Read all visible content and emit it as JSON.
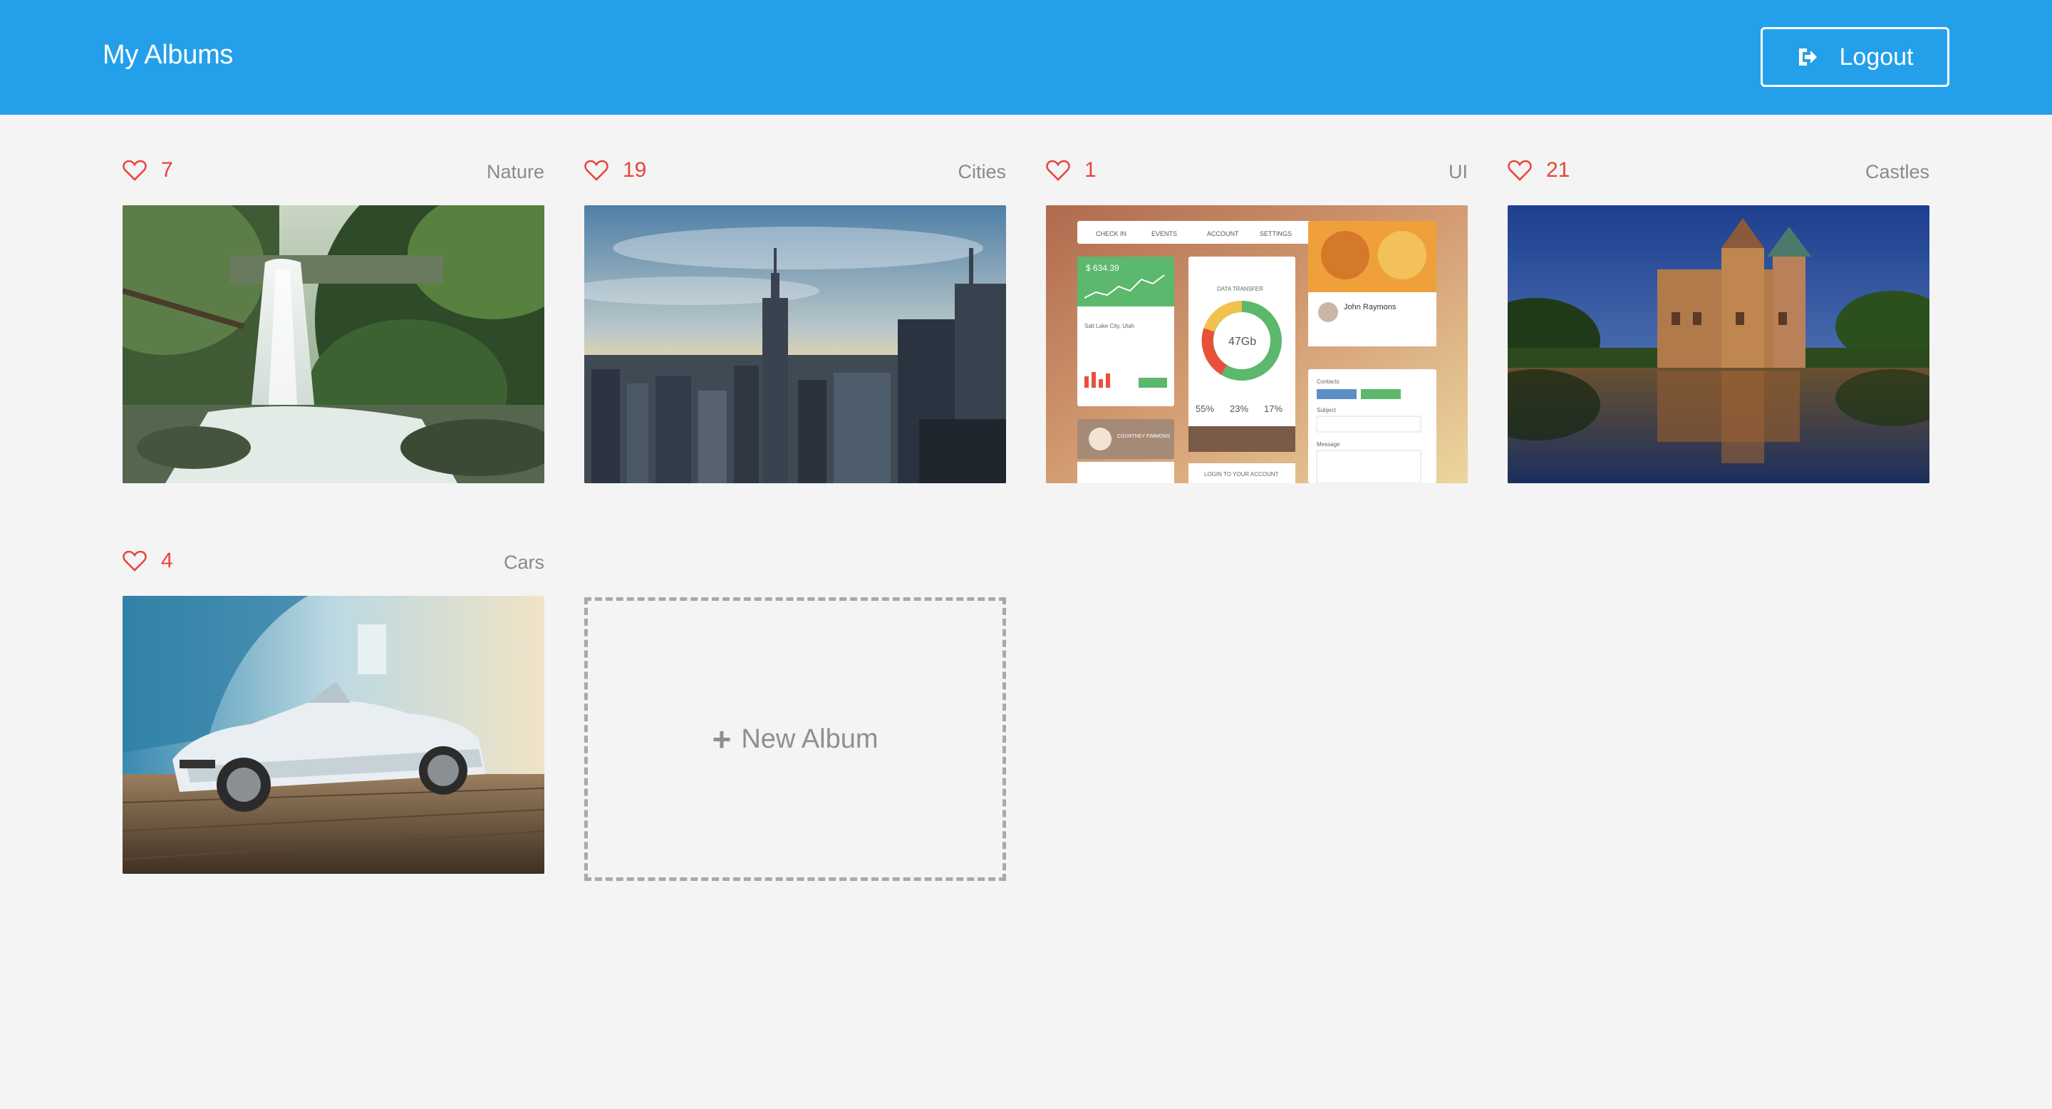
{
  "header": {
    "title": "My Albums",
    "logout_label": "Logout"
  },
  "albums": [
    {
      "likes": "7",
      "category": "Nature",
      "image": "waterfall-forest"
    },
    {
      "likes": "19",
      "category": "Cities",
      "image": "city-skyline-sunset"
    },
    {
      "likes": "1",
      "category": "UI",
      "image": "ui-dashboard-kit"
    },
    {
      "likes": "21",
      "category": "Castles",
      "image": "castle-on-lake"
    },
    {
      "likes": "4",
      "category": "Cars",
      "image": "white-convertible-car"
    }
  ],
  "new_album": {
    "plus": "+",
    "label": "New Album"
  },
  "ui_thumb_text": {
    "nav_check_in": "CHECK IN",
    "nav_events": "EVENTS",
    "nav_account": "ACCOUNT",
    "nav_settings": "SETTINGS",
    "stat_value": "$ 634.39",
    "location": "Salt Lake City, Utah",
    "data_transfer": "DATA TRANSFER",
    "donut_value": "47Gb",
    "pct_1": "55%",
    "pct_2": "23%",
    "pct_3": "17%",
    "profile_name": "John Raymons",
    "profile_name_2": "COURTNEY FIMMONS",
    "contacts": "Contacts",
    "subject": "Subject",
    "message": "Message",
    "login": "LOGIN TO YOUR ACCOUNT"
  },
  "icons": {
    "heart": "heart-icon",
    "logout": "logout-icon"
  },
  "colors": {
    "header_bg": "#24a0ea",
    "page_bg": "#f4f4f4",
    "likes": "#e8443c",
    "category": "#8a8a8a"
  }
}
